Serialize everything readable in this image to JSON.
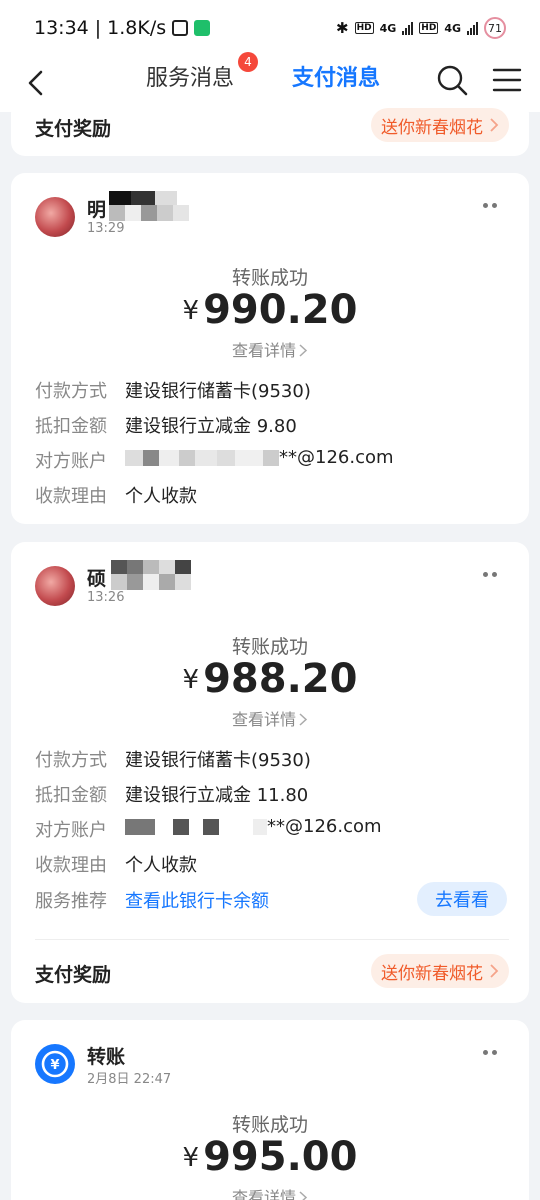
{
  "status_bar": {
    "time": "13:34",
    "separator": "|",
    "net_speed": "1.8K/s",
    "battery": "71",
    "network_1": "4G",
    "network_2": "4G",
    "hd_1": "HD",
    "hd_2": "HD"
  },
  "nav": {
    "tab_service": "服务消息",
    "tab_service_badge": "4",
    "tab_pay": "支付消息",
    "active_color": "#1677ff"
  },
  "reward": {
    "title": "支付奖励",
    "pill": "送你新春烟花"
  },
  "cards": [
    {
      "sender": "明",
      "time": "13:29",
      "status": "转账成功",
      "currency": "¥",
      "amount": "990.20",
      "detail_link": "查看详情",
      "rows": [
        {
          "key": "付款方式",
          "value": "建设银行储蓄卡(9530)"
        },
        {
          "key": "抵扣金额",
          "value": "建设银行立减金 9.80"
        },
        {
          "key": "对方账户",
          "value": "**@126.com"
        },
        {
          "key": "收款理由",
          "value": "个人收款"
        }
      ]
    },
    {
      "sender": "硕",
      "time": "13:26",
      "status": "转账成功",
      "currency": "¥",
      "amount": "988.20",
      "detail_link": "查看详情",
      "rows": [
        {
          "key": "付款方式",
          "value": "建设银行储蓄卡(9530)"
        },
        {
          "key": "抵扣金额",
          "value": "建设银行立减金 11.80"
        },
        {
          "key": "对方账户",
          "value": "**@126.com"
        },
        {
          "key": "收款理由",
          "value": "个人收款"
        }
      ],
      "service": {
        "key": "服务推荐",
        "value": "查看此银行卡余额",
        "button": "去看看"
      },
      "reward_title": "支付奖励",
      "reward_pill": "送你新春烟花"
    },
    {
      "sender": "转账",
      "time": "2月8日 22:47",
      "status": "转账成功",
      "currency": "¥",
      "amount": "995.00",
      "detail_link": "查看详情"
    }
  ]
}
